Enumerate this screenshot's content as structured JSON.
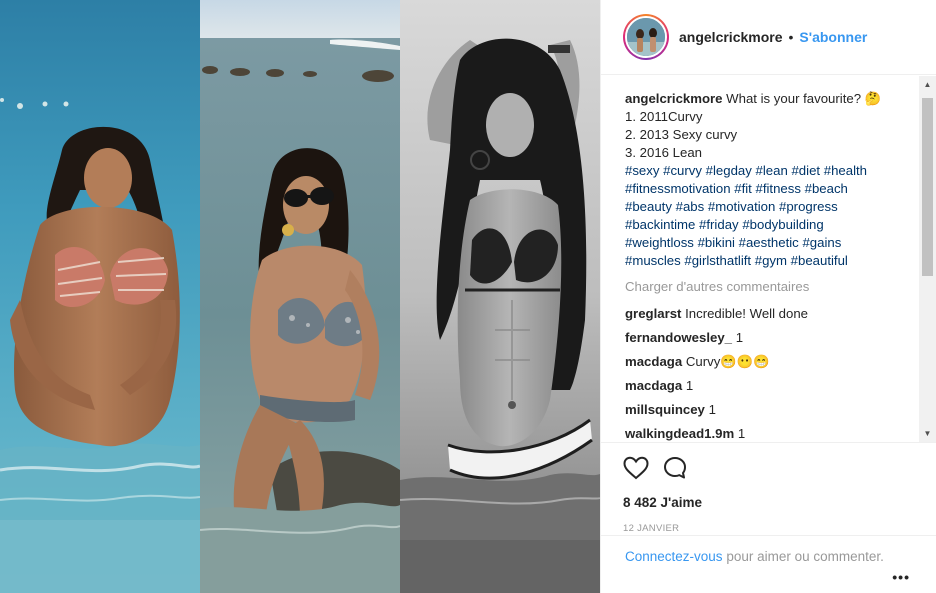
{
  "post": {
    "username": "angelcrickmore",
    "separator": "•",
    "follow_label": "S'abonner",
    "caption_lines": [
      "What is your favourite? 🤔",
      "1. 2011Curvy",
      "2. 2013 Sexy curvy",
      "3. 2016 Lean"
    ],
    "hashtags": [
      "#sexy",
      "#curvy",
      "#legday",
      "#lean",
      "#diet",
      "#health",
      "#fitnessmotivation",
      "#fit",
      "#fitness",
      "#beach",
      "#beauty",
      "#abs",
      "#motivation",
      "#progress",
      "#backintime",
      "#friday",
      "#bodybuilding",
      "#weightloss",
      "#bikini",
      "#aesthetic",
      "#gains",
      "#muscles",
      "#girlsthatlift",
      "#gym",
      "#beautiful"
    ],
    "load_more_label": "Charger d'autres commentaires",
    "comments": [
      {
        "user": "greglarst",
        "text": "Incredible! Well done"
      },
      {
        "user": "fernandowesley_",
        "text": "1"
      },
      {
        "user": "macdaga",
        "text": "Curvy😁😶😁"
      },
      {
        "user": "macdaga",
        "text": "1"
      },
      {
        "user": "millsquincey",
        "text": "1"
      },
      {
        "user": "walkingdead1.9m",
        "text": "1"
      }
    ],
    "likes": "8 482 J'aime",
    "date": "12 JANVIER",
    "login_link": "Connectez-vous",
    "login_rest": " pour aimer ou commenter.",
    "more_label": "•••"
  },
  "icons": {
    "like": "heart-icon",
    "comment": "comment-icon",
    "more": "more-options-icon"
  },
  "colors": {
    "link_blue": "#3897f0",
    "hashtag": "#003569",
    "muted": "#999999",
    "text": "#262626"
  }
}
